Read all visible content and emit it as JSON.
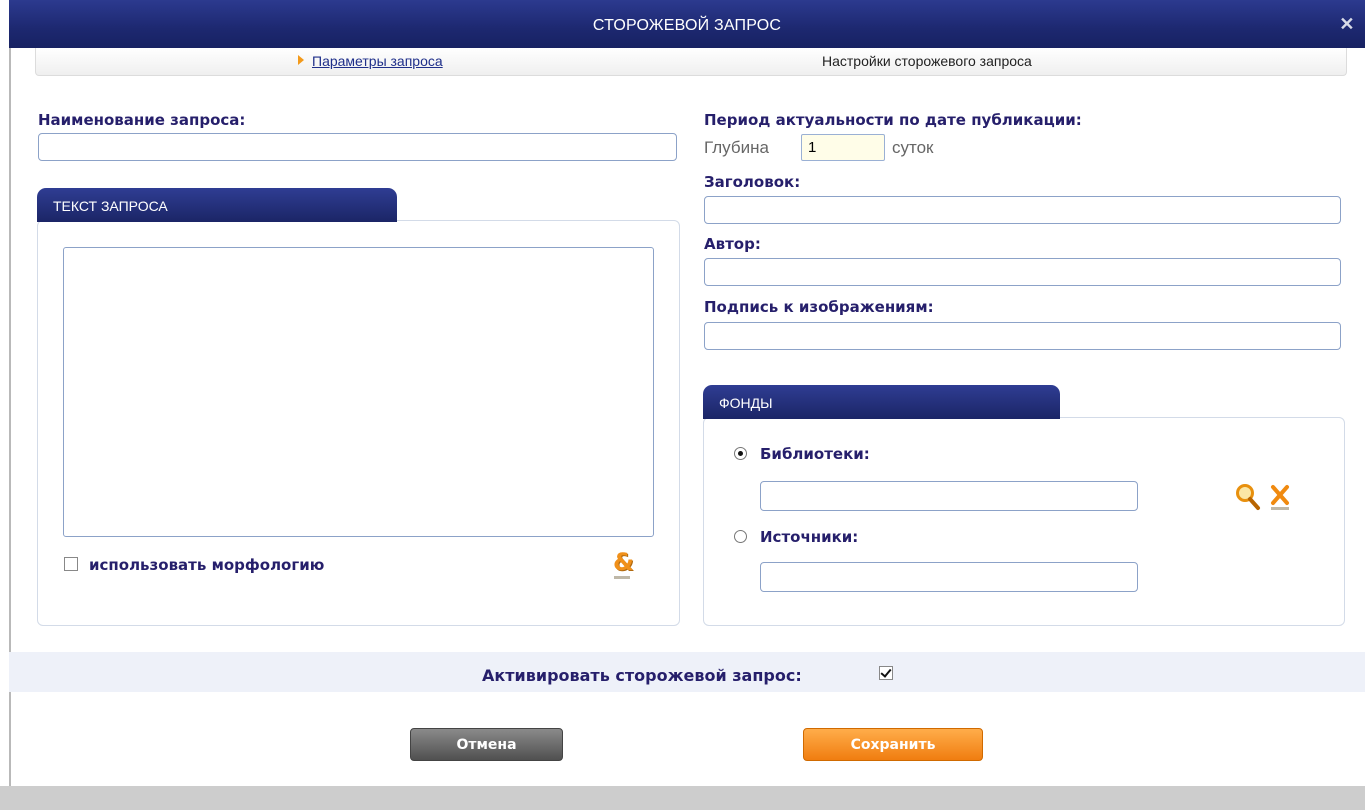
{
  "dialog": {
    "title": "СТОРОЖЕВОЙ ЗАПРОС",
    "close": "✕"
  },
  "tabs": [
    {
      "label": "Параметры запроса",
      "active": true
    },
    {
      "label": "Настройки сторожевого запроса",
      "active": false
    }
  ],
  "query_name": {
    "label": "Наименование запроса:",
    "value": ""
  },
  "query_text": {
    "panel_title": "ТЕКСТ ЗАПРОСА",
    "value": "",
    "morphology_label": "использовать морфологию",
    "morphology_checked": false
  },
  "period": {
    "label": "Период актуальности по дате публикации:",
    "depth_prefix": "Глубина",
    "depth_value": "1",
    "depth_suffix": "суток"
  },
  "fields": {
    "title_label": "Заголовок:",
    "author_label": "Автор:",
    "caption_label": "Подпись к изображениям:"
  },
  "funds": {
    "panel_title": "ФОНДЫ",
    "libraries_label": "Библиотеки:",
    "libraries_selected": true,
    "sources_label": "Источники:",
    "sources_selected": false
  },
  "activate": {
    "label": "Активировать сторожевой запрос:",
    "checked": true
  },
  "buttons": {
    "cancel": "Отмена",
    "save": "Сохранить"
  },
  "colors": {
    "header": "#1d2870",
    "label": "#261f6b",
    "accent": "#f07d10"
  }
}
